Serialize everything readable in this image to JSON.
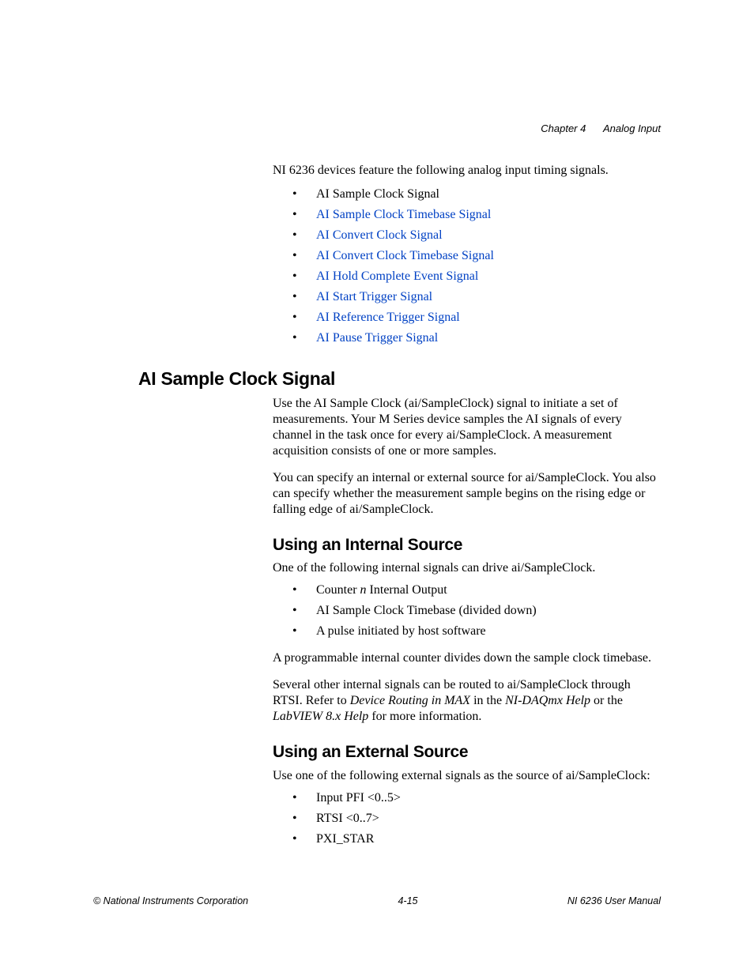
{
  "header": {
    "chapter": "Chapter 4",
    "title": "Analog Input"
  },
  "intro": "NI 6236 devices feature the following analog input timing signals.",
  "signal_list": {
    "item0": "AI Sample Clock Signal",
    "item1": "AI Sample Clock Timebase Signal",
    "item2": "AI Convert Clock Signal",
    "item3": "AI Convert Clock Timebase Signal",
    "item4": "AI Hold Complete Event Signal",
    "item5": "AI Start Trigger Signal",
    "item6": "AI Reference Trigger Signal",
    "item7": "AI Pause Trigger Signal"
  },
  "section1": {
    "heading": "AI Sample Clock Signal",
    "p1": "Use the AI Sample Clock (ai/SampleClock) signal to initiate a set of measurements. Your M Series device samples the AI signals of every channel in the task once for every ai/SampleClock. A measurement acquisition consists of one or more samples.",
    "p2": "You can specify an internal or external source for ai/SampleClock. You also can specify whether the measurement sample begins on the rising edge or falling edge of ai/SampleClock."
  },
  "section2": {
    "heading": "Using an Internal Source",
    "p1": "One of the following internal signals can drive ai/SampleClock.",
    "list": {
      "pre0": "Counter ",
      "n": "n",
      "post0": " Internal Output",
      "item1": "AI Sample Clock Timebase (divided down)",
      "item2": "A pulse initiated by host software"
    },
    "p2": "A programmable internal counter divides down the sample clock timebase.",
    "p3a": "Several other internal signals can be routed to ai/SampleClock through RTSI. Refer to ",
    "p3b": "Device Routing in MAX",
    "p3c": " in the ",
    "p3d": "NI-DAQmx Help",
    "p3e": " or the ",
    "p3f": "LabVIEW 8.x Help",
    "p3g": " for more information."
  },
  "section3": {
    "heading": "Using an External Source",
    "p1": "Use one of the following external signals as the source of ai/SampleClock:",
    "list": {
      "item0": "Input PFI <0..5>",
      "item1": "RTSI <0..7>",
      "item2": "PXI_STAR"
    }
  },
  "footer": {
    "left": "© National Instruments Corporation",
    "center": "4-15",
    "right": "NI 6236 User Manual"
  }
}
